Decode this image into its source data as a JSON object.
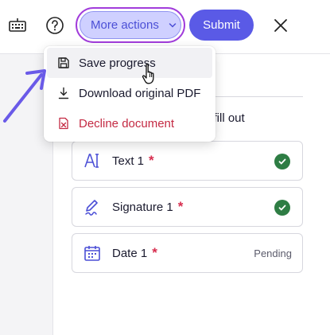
{
  "toolbar": {
    "more_actions_label": "More actions",
    "submit_label": "Submit"
  },
  "instructions": {
    "fill_out_text": "o fill out"
  },
  "dropdown": {
    "items": [
      {
        "label": "Save progress",
        "icon": "save-icon"
      },
      {
        "label": "Download original PDF",
        "icon": "download-icon"
      },
      {
        "label": "Decline document",
        "icon": "decline-document-icon"
      }
    ]
  },
  "fields": [
    {
      "label": "Text 1",
      "required_mark": "*",
      "icon": "text-field-icon",
      "status": "completed"
    },
    {
      "label": "Signature 1",
      "required_mark": "*",
      "icon": "signature-icon",
      "status": "completed"
    },
    {
      "label": "Date 1",
      "required_mark": "*",
      "icon": "calendar-icon",
      "status_text": "Pending"
    }
  ],
  "colors": {
    "accent": "#5a5ae6",
    "focus_ring": "#a13cdb",
    "required": "#d72d4e",
    "completed": "#2e7d44",
    "danger": "#c42a43",
    "annotation_arrow": "#6a5ae8"
  }
}
